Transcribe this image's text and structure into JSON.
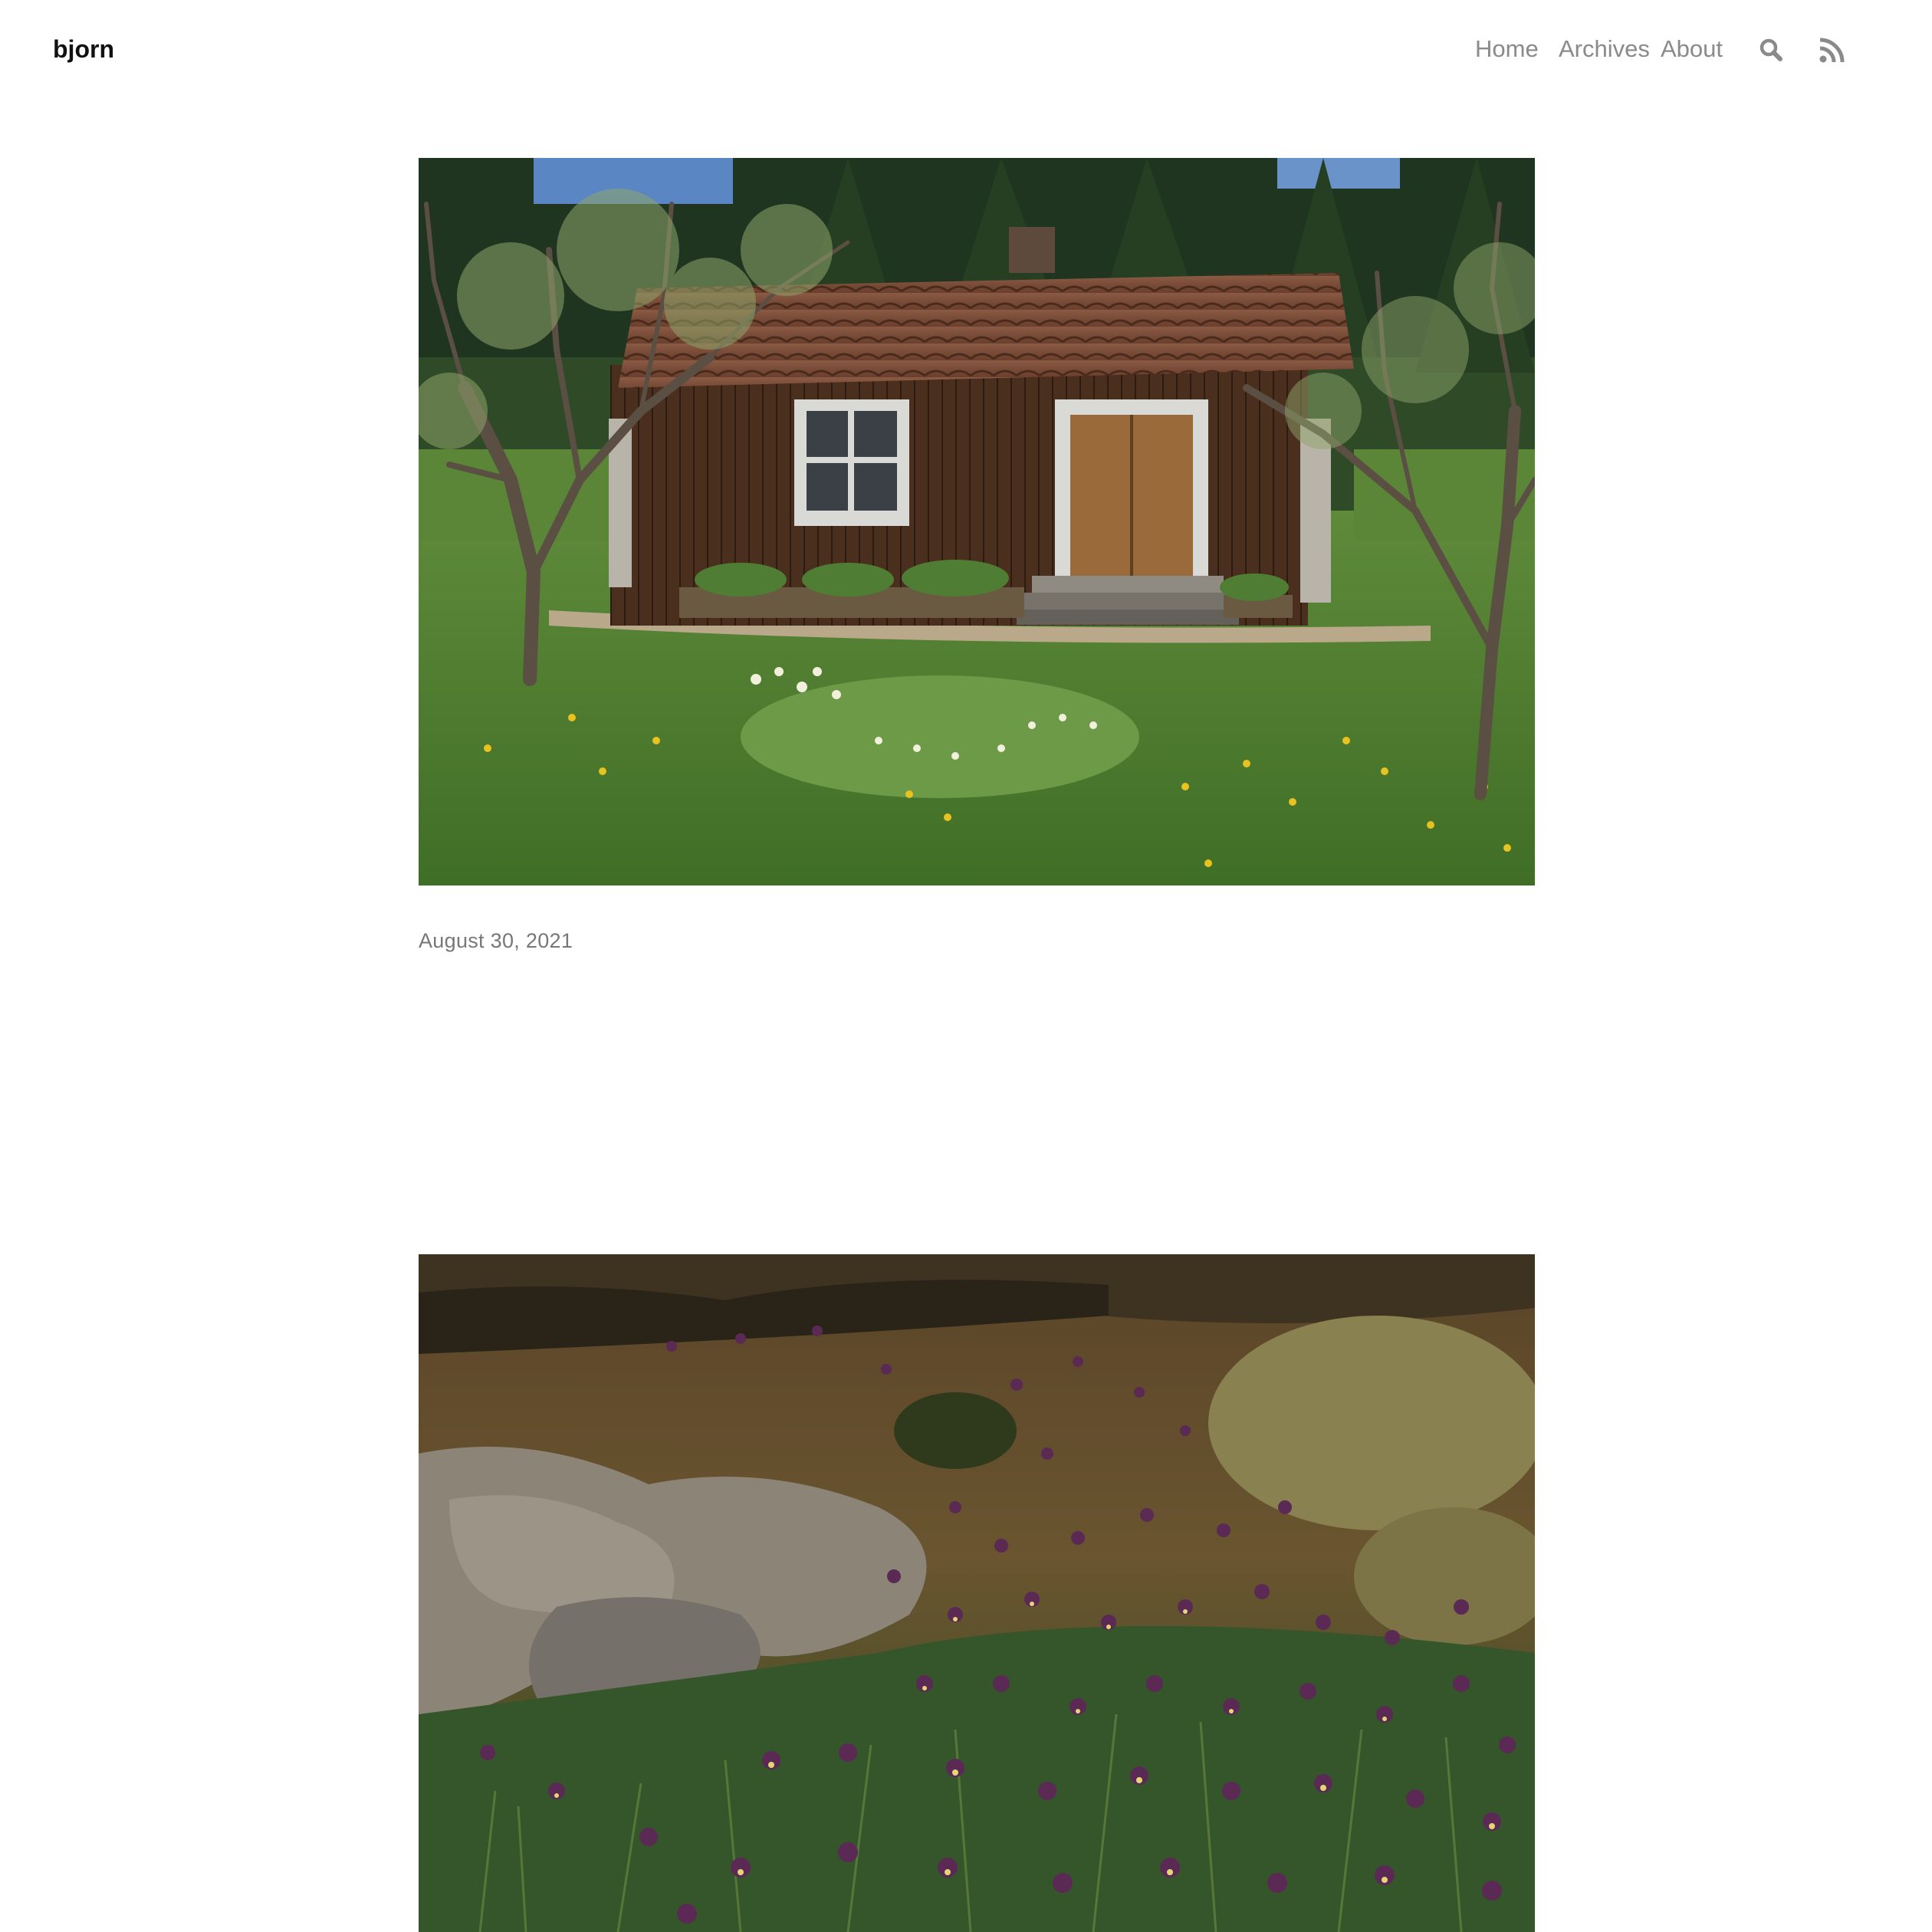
{
  "site": {
    "title": "bjorn"
  },
  "nav": {
    "items": [
      {
        "label": "Home"
      },
      {
        "label": "Archives"
      },
      {
        "label": "About"
      }
    ],
    "search_icon": "search-icon",
    "rss_icon": "rss-icon"
  },
  "posts": [
    {
      "date": "August 30, 2021",
      "photo": "red wooden cottage with tiled roof in a green meadow with bare fruit trees and daffodils"
    },
    {
      "photo": "wild purple pansies growing among moss, grass and lichen-covered rock"
    }
  ],
  "colors": {
    "background": "#ffffff",
    "title": "#111111",
    "nav": "#8a8a8a",
    "date": "#777777"
  }
}
